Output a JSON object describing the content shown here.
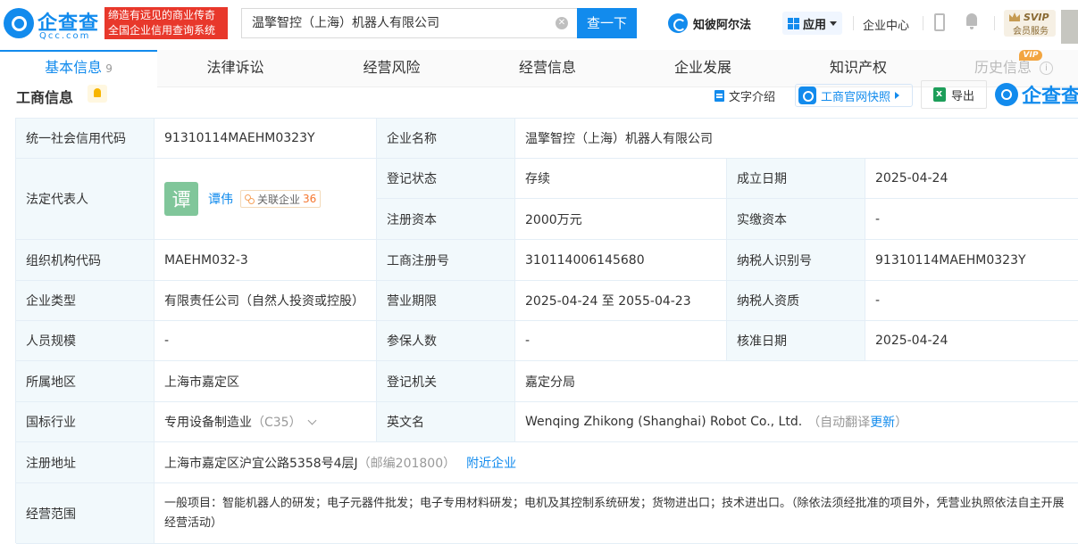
{
  "header": {
    "logo_name": "企查查",
    "logo_url": "Qcc.com",
    "slogan_line1": "缔造有远见的商业传奇",
    "slogan_line2": "全国企业信用查询系统",
    "search_value": "温擎智控（上海）机器人有限公司",
    "search_button": "查一下",
    "alpha_label": "知彼阿尔法",
    "apps_label": "应用",
    "enterprise_center": "企业中心",
    "svip_label": "SVIP",
    "svip_sub": "会员服务"
  },
  "tabs": [
    {
      "label": "基本信息",
      "count": "9"
    },
    {
      "label": "法律诉讼"
    },
    {
      "label": "经营风险"
    },
    {
      "label": "经营信息"
    },
    {
      "label": "企业发展"
    },
    {
      "label": "知识产权"
    },
    {
      "label": "历史信息"
    }
  ],
  "vip_tag": "VIP",
  "section": {
    "title": "工商信息",
    "text_intro": "文字介绍",
    "snapshot": "工商官网快照",
    "export": "导出",
    "watermark": "企查查"
  },
  "company": {
    "credit_code_label": "统一社会信用代码",
    "credit_code": "91310114MAEHM0323Y",
    "name_label": "企业名称",
    "name": "温擎智控（上海）机器人有限公司",
    "legal_rep_label": "法定代表人",
    "legal_rep_avatar": "谭",
    "legal_rep": "谭伟",
    "related_label": "关联企业",
    "related_count": "36",
    "status_label": "登记状态",
    "status": "存续",
    "found_date_label": "成立日期",
    "found_date": "2025-04-24",
    "reg_capital_label": "注册资本",
    "reg_capital": "2000万元",
    "paid_capital_label": "实缴资本",
    "paid_capital": "-",
    "org_code_label": "组织机构代码",
    "org_code": "MAEHM032-3",
    "reg_no_label": "工商注册号",
    "reg_no": "310114006145680",
    "taxpayer_id_label": "纳税人识别号",
    "taxpayer_id": "91310114MAEHM0323Y",
    "type_label": "企业类型",
    "type": "有限责任公司（自然人投资或控股）",
    "term_label": "营业期限",
    "term": "2025-04-24 至 2055-04-23",
    "taxpayer_qual_label": "纳税人资质",
    "taxpayer_qual": "-",
    "staff_label": "人员规模",
    "staff": "-",
    "insured_label": "参保人数",
    "insured": "-",
    "approval_date_label": "核准日期",
    "approval_date": "2025-04-24",
    "region_label": "所属地区",
    "region": "上海市嘉定区",
    "authority_label": "登记机关",
    "authority": "嘉定分局",
    "industry_label": "国标行业",
    "industry": "专用设备制造业",
    "industry_code": "（C35）",
    "english_label": "英文名",
    "english": "Wenqing Zhikong (Shanghai) Robot Co., Ltd.",
    "auto_translate": "（自动翻译",
    "update": "更新",
    "close_paren": "）",
    "address_label": "注册地址",
    "address": "上海市嘉定区沪宜公路5358号4层J",
    "postcode": "（邮编201800）",
    "nearby": "附近企业",
    "scope_label": "经营范围",
    "scope": "一般项目：智能机器人的研发；电子元器件批发；电子专用材料研发；电机及其控制系统研发；货物进出口；技术进出口。（除依法须经批准的项目外，凭营业执照依法自主开展经营活动）"
  }
}
